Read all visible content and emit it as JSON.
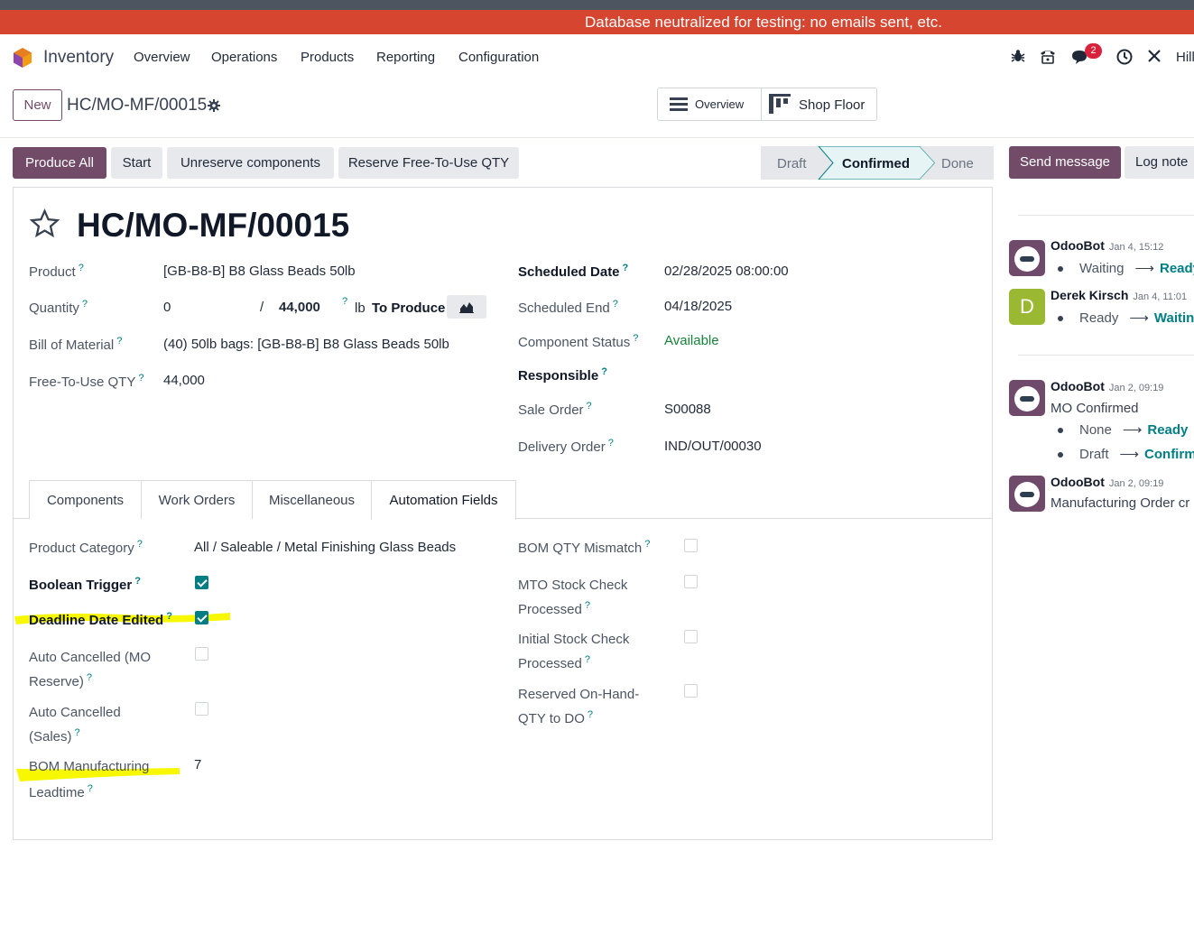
{
  "banner": {
    "text": "Database neutralized for testing: no emails sent, etc."
  },
  "nav": {
    "app": "Inventory",
    "menu": [
      "Overview",
      "Operations",
      "Products",
      "Reporting",
      "Configuration"
    ],
    "chat_badge": "2",
    "user_partial": "Hill"
  },
  "control": {
    "new_label": "New",
    "breadcrumb": "HC/MO-MF/00015",
    "overview_label": "Overview",
    "shop_floor_label": "Shop Floor"
  },
  "actions": {
    "produce_all": "Produce All",
    "start": "Start",
    "unreserve": "Unreserve components",
    "reserve_free": "Reserve Free-To-Use QTY"
  },
  "statusbar": {
    "steps": [
      "Draft",
      "Confirmed",
      "Done"
    ],
    "active": "Confirmed"
  },
  "chatter_buttons": {
    "send": "Send message",
    "log": "Log note"
  },
  "record": {
    "title": "HC/MO-MF/00015",
    "left": {
      "product_label": "Product",
      "product_value": "[GB-B8-B] B8 Glass Beads 50lb",
      "quantity_label": "Quantity",
      "qty_done": "0",
      "qty_sep": "/",
      "qty_target": "44,000",
      "qty_uom": "lb",
      "to_produce": "To Produce",
      "bom_label": "Bill of Material",
      "bom_value": "(40) 50lb bags: [GB-B8-B] B8 Glass Beads 50lb",
      "free_label": "Free-To-Use QTY",
      "free_value": "44,000"
    },
    "right": {
      "sched_date_label": "Scheduled Date",
      "sched_date_value": "02/28/2025 08:00:00",
      "sched_end_label": "Scheduled End",
      "sched_end_value": "04/18/2025",
      "comp_status_label": "Component Status",
      "comp_status_value": "Available",
      "responsible_label": "Responsible",
      "sale_order_label": "Sale Order",
      "sale_order_value": "S00088",
      "delivery_label": "Delivery Order",
      "delivery_value": "IND/OUT/00030"
    }
  },
  "tabs": [
    "Components",
    "Work Orders",
    "Miscellaneous",
    "Automation Fields"
  ],
  "active_tab": "Automation Fields",
  "automation": {
    "product_category_label": "Product Category",
    "product_category_value": "All / Saleable / Metal Finishing Glass Beads",
    "boolean_trigger_label": "Boolean Trigger",
    "boolean_trigger": true,
    "deadline_edited_label": "Deadline Date Edited",
    "deadline_edited": true,
    "auto_cancel_mo_label1": "Auto Cancelled (MO",
    "auto_cancel_mo_label2": "Reserve)",
    "auto_cancel_mo": false,
    "auto_cancel_sales_label1": "Auto Cancelled",
    "auto_cancel_sales_label2": "(Sales)",
    "auto_cancel_sales": false,
    "bom_leadtime_label1": "BOM Manufacturing",
    "bom_leadtime_label2": "Leadtime",
    "bom_leadtime_value": "7",
    "bom_qty_mismatch_label": "BOM QTY Mismatch",
    "mto_label1": "MTO Stock Check",
    "mto_label2": "Processed",
    "initial_label1": "Initial Stock Check",
    "initial_label2": "Processed",
    "reserved_label1": "Reserved On-Hand-",
    "reserved_label2": "QTY to DO"
  },
  "chatter": [
    {
      "author": "OdooBot",
      "time": "Jan 4, 15:12",
      "from": "Waiting",
      "to": "Ready"
    },
    {
      "author": "Derek Kirsch",
      "initial": "D",
      "time": "Jan 4, 11:01",
      "from": "Ready",
      "to": "Waiting"
    },
    {
      "author": "OdooBot",
      "time": "Jan 2, 09:19",
      "text": "MO Confirmed",
      "c1_from": "None",
      "c1_to": "Ready",
      "c1_extra": "(",
      "c2_from": "Draft",
      "c2_to": "Confirme"
    },
    {
      "author": "OdooBot",
      "time": "Jan 2, 09:19",
      "text": "Manufacturing Order cr"
    }
  ],
  "colors": {
    "banner": "#d5452f",
    "primary": "#714b67",
    "link": "#017e84",
    "highlight": "#f7f700"
  },
  "icons": {
    "star": "star-icon",
    "gear": "gear-icon",
    "bug": "bug-icon",
    "phone": "phone-icon",
    "chat": "chat-icon",
    "clock": "clock-icon",
    "tools": "tools-icon",
    "chart": "area-chart-icon"
  }
}
